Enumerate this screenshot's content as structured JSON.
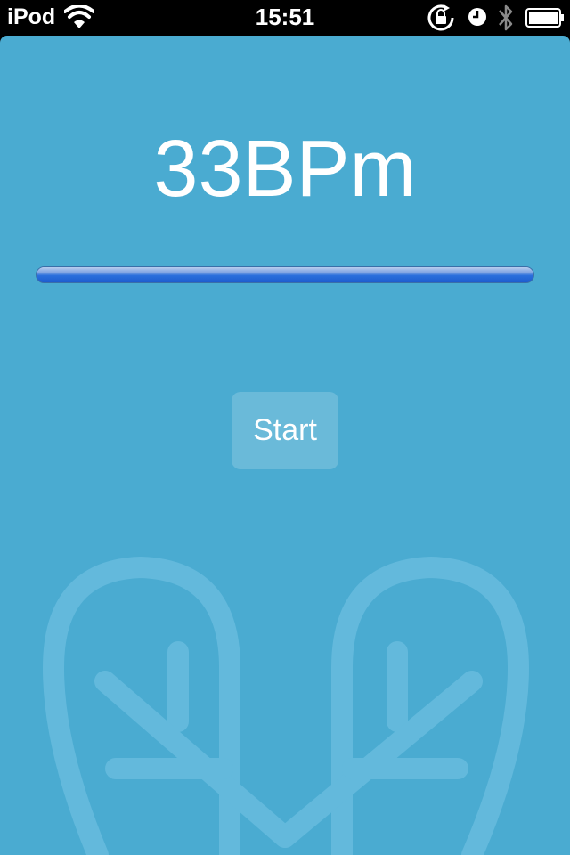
{
  "status_bar": {
    "carrier": "iPod",
    "time": "15:51",
    "icons": [
      "wifi-icon",
      "rotation-lock-icon",
      "alarm-icon",
      "bluetooth-icon",
      "battery-icon"
    ]
  },
  "bpm": {
    "text": "33BPm"
  },
  "progress": {
    "value": 1.0
  },
  "start_button": {
    "label": "Start"
  },
  "colors": {
    "background": "#4aabd1",
    "text": "#ffffff",
    "progress": "#2a6fdc"
  }
}
